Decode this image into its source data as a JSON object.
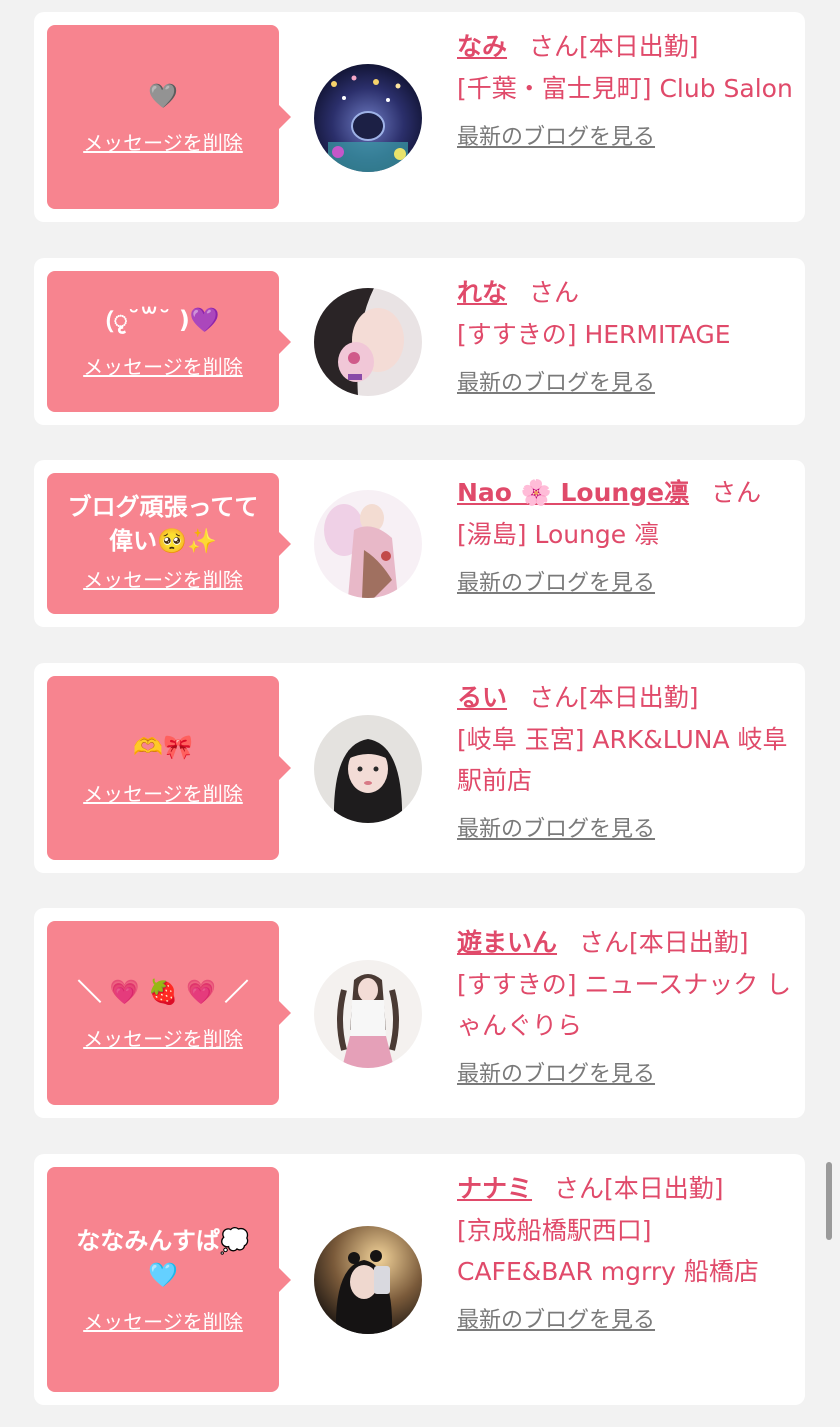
{
  "colors": {
    "bubble": "#f7848f",
    "accent": "#e04a6a",
    "link_gray": "#7a7a7a",
    "background": "#f2f2f2"
  },
  "items": [
    {
      "message": "🩶",
      "delete_label": "メッセージを削除",
      "name": "なみ",
      "suffix": "さん[本日出勤]",
      "shop": "[千葉・富士見町] Club Salon",
      "blog_link": "最新のブログを見る"
    },
    {
      "message": "(ृ˘꒳˘ )💜",
      "delete_label": "メッセージを削除",
      "name": "れな",
      "suffix": "さん",
      "shop": "[すすきの] HERMITAGE",
      "blog_link": "最新のブログを見る"
    },
    {
      "message": "ブログ頑張ってて偉い🥺✨",
      "delete_label": "メッセージを削除",
      "name": "Nao 🌸 Lounge凛",
      "suffix": "さん",
      "shop": "[湯島] Lounge 凛",
      "blog_link": "最新のブログを見る"
    },
    {
      "message": "🫶🎀",
      "delete_label": "メッセージを削除",
      "name": "るい",
      "suffix": "さん[本日出勤]",
      "shop": "[岐阜 玉宮] ARK&LUNA 岐阜駅前店",
      "blog_link": "最新のブログを見る"
    },
    {
      "message": "＼ 💗 🍓 💗 ／",
      "delete_label": "メッセージを削除",
      "name": "遊まいん",
      "suffix": "さん[本日出勤]",
      "shop": "[すすきの] ニュースナック しゃんぐりら",
      "blog_link": "最新のブログを見る"
    },
    {
      "message": "ななみんすぱ💭\n🩵",
      "delete_label": "メッセージを削除",
      "name": "ナナミ",
      "suffix": "さん[本日出勤]",
      "shop": "[京成船橋駅西口] CAFE&BAR mgrry 船橋店",
      "blog_link": "最新のブログを見る"
    }
  ]
}
